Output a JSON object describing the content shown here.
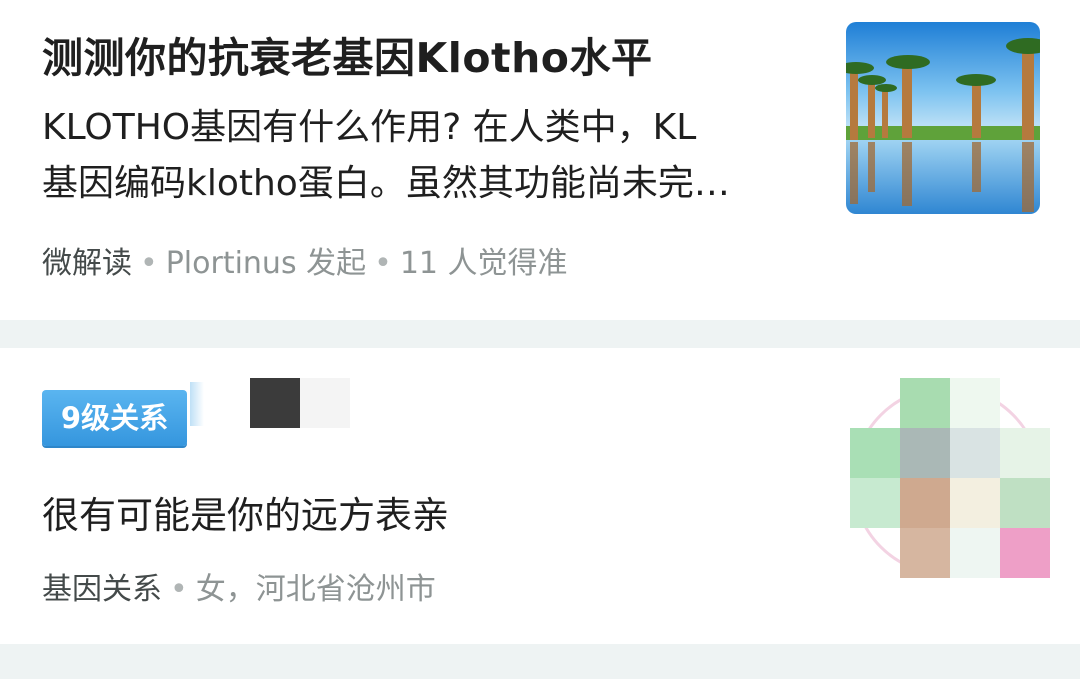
{
  "article": {
    "title": "测测你的抗衰老基因Klotho水平",
    "summary_line1": "KLOTHO基因有什么作用? 在人类中，KL",
    "summary_line2": "基因编码klotho蛋白。虽然其功能尚未完…",
    "source": "微解读",
    "initiator": "Plortinus 发起",
    "agree_count": "11 人觉得准",
    "thumbnail_icon": "baobab-trees-lake-image"
  },
  "relative": {
    "level_badge": "9级关系",
    "description": "很有可能是你的远方表亲",
    "category": "基因关系",
    "profile": "女，河北省沧州市",
    "avatar_icon": "pixelated-avatar"
  },
  "colors": {
    "badge_blue": "#3da2e6",
    "page_background": "#eef3f3",
    "meta_gray": "#8e9494"
  }
}
